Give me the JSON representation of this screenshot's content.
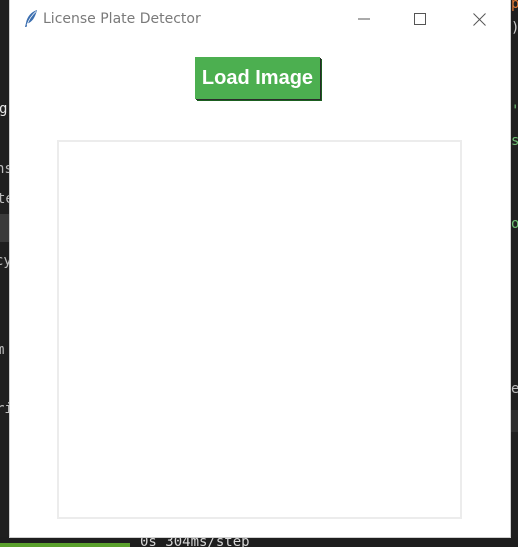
{
  "window": {
    "title": "License Plate Detector",
    "icon": "feather-icon",
    "controls": {
      "minimize": "minimize-icon",
      "maximize": "maximize-icon",
      "close": "close-icon"
    }
  },
  "toolbar": {
    "load_label": "Load Image"
  },
  "image_panel": {
    "empty": true
  },
  "background": {
    "left_fragments": [
      "g",
      "ns",
      "te",
      "cy",
      "m",
      "ri"
    ],
    "right_fragments": [
      "p",
      ")",
      "'",
      "s",
      "o",
      "e"
    ],
    "bottom_text": "0s 304ms/step"
  },
  "colors": {
    "accent": "#4caf50",
    "window_bg": "#ffffff",
    "title_text": "#7a7a7a",
    "panel_border": "#ececec"
  }
}
